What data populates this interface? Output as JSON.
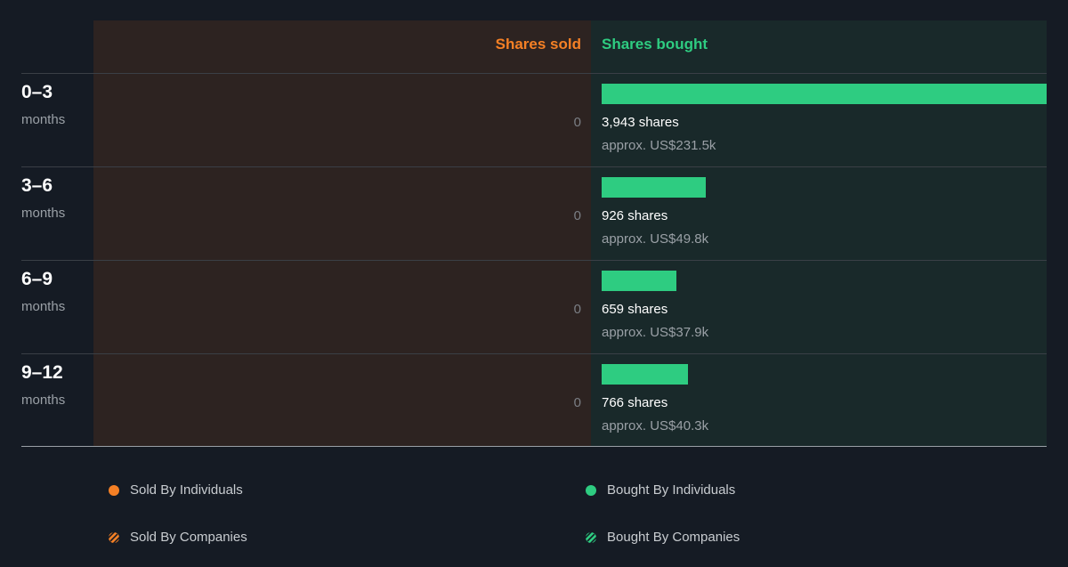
{
  "header": {
    "sold_label": "Shares sold",
    "bought_label": "Shares bought"
  },
  "chart_data": {
    "type": "bar",
    "categories": [
      "0–3 months",
      "3–6 months",
      "6–9 months",
      "9–12 months"
    ],
    "series": [
      {
        "name": "Shares sold",
        "values": [
          0,
          0,
          0,
          0
        ]
      },
      {
        "name": "Shares bought",
        "values": [
          3943,
          926,
          659,
          766
        ]
      }
    ],
    "max_value": 3943
  },
  "rows": [
    {
      "period": "0–3",
      "unit": "months",
      "sold": "0",
      "shares": "3,943 shares",
      "approx": "approx. US$231.5k"
    },
    {
      "period": "3–6",
      "unit": "months",
      "sold": "0",
      "shares": "926 shares",
      "approx": "approx. US$49.8k"
    },
    {
      "period": "6–9",
      "unit": "months",
      "sold": "0",
      "shares": "659 shares",
      "approx": "approx. US$37.9k"
    },
    {
      "period": "9–12",
      "unit": "months",
      "sold": "0",
      "shares": "766 shares",
      "approx": "approx. US$40.3k"
    }
  ],
  "legend": {
    "sold_individuals": "Sold By Individuals",
    "sold_companies": "Sold By Companies",
    "bought_individuals": "Bought By Individuals",
    "bought_companies": "Bought By Companies"
  },
  "colors": {
    "sold": "#f58025",
    "bought": "#2ecc81",
    "sold_panel": "#2d2321",
    "bought_panel": "#19292a",
    "background": "#151b24"
  }
}
